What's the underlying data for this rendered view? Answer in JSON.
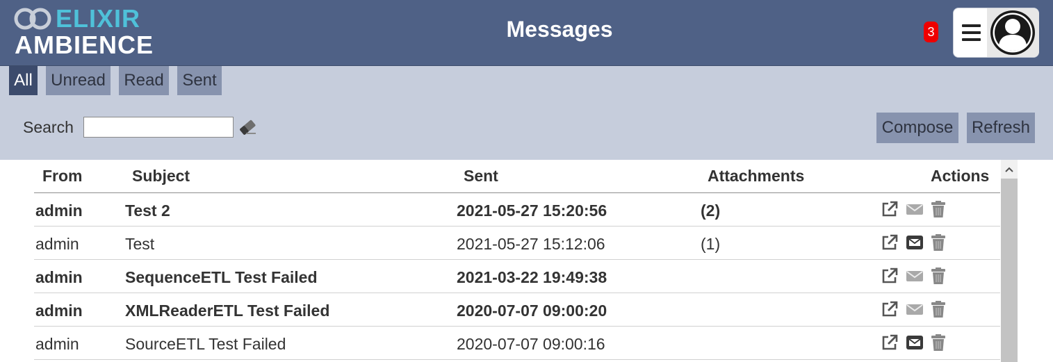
{
  "header": {
    "logo_top": "ELIXIR",
    "logo_bottom": "AMBIENCE",
    "title": "Messages",
    "notification_count": "3"
  },
  "tabs": [
    {
      "label": "All",
      "active": true
    },
    {
      "label": "Unread",
      "active": false
    },
    {
      "label": "Read",
      "active": false
    },
    {
      "label": "Sent",
      "active": false
    }
  ],
  "search": {
    "label": "Search",
    "value": "",
    "placeholder": ""
  },
  "buttons": {
    "compose": "Compose",
    "refresh": "Refresh"
  },
  "table": {
    "columns": [
      "From",
      "Subject",
      "Sent",
      "Attachments",
      "Actions"
    ],
    "rows": [
      {
        "from": "admin",
        "subject": "Test 2",
        "sent": "2021-05-27 15:20:56",
        "attachments": "(2)",
        "unread": true
      },
      {
        "from": "admin",
        "subject": "Test",
        "sent": "2021-05-27 15:12:06",
        "attachments": "(1)",
        "unread": false
      },
      {
        "from": "admin",
        "subject": "SequenceETL Test Failed",
        "sent": "2021-03-22 19:49:38",
        "attachments": "",
        "unread": true
      },
      {
        "from": "admin",
        "subject": "XMLReaderETL Test Failed",
        "sent": "2020-07-07 09:00:20",
        "attachments": "",
        "unread": true
      },
      {
        "from": "admin",
        "subject": "SourceETL Test Failed",
        "sent": "2020-07-07 09:00:16",
        "attachments": "",
        "unread": false
      }
    ]
  },
  "icons": {
    "open": "external-link-icon",
    "mark_unread": "envelope-outline-icon",
    "mark_read": "envelope-filled-icon",
    "delete": "trash-icon",
    "clear_search": "eraser-icon",
    "menu": "hamburger-menu-icon",
    "user": "user-avatar-icon"
  },
  "colors": {
    "header_bg": "#4f6186",
    "toolbar_bg": "#c6cddc",
    "tab_bg": "#8793ae",
    "tab_active_bg": "#3c4b6c",
    "logo_accent": "#4fc1d9",
    "badge": "#ee0000"
  }
}
